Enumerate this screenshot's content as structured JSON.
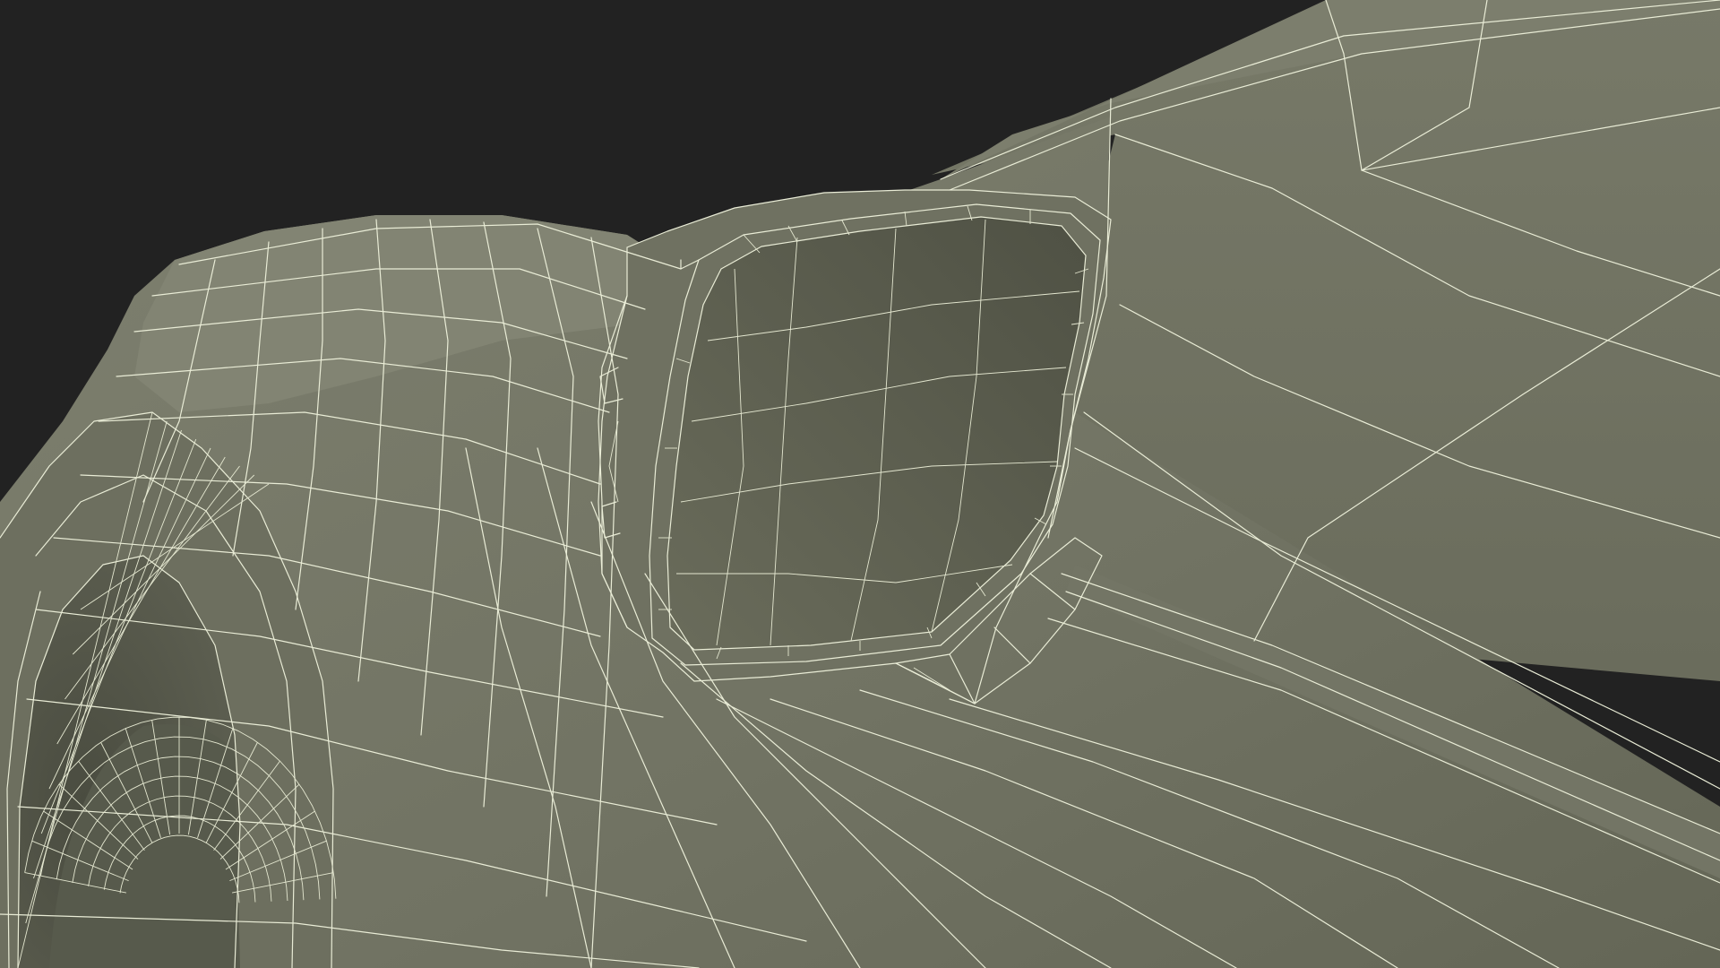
{
  "scene": {
    "subject": "wireframe-render",
    "colors": {
      "background": "#222222",
      "surface_light": "#7f8070",
      "surface_mid": "#6e705f",
      "surface_dark": "#56584a",
      "wire": "#e9ecd6"
    }
  }
}
